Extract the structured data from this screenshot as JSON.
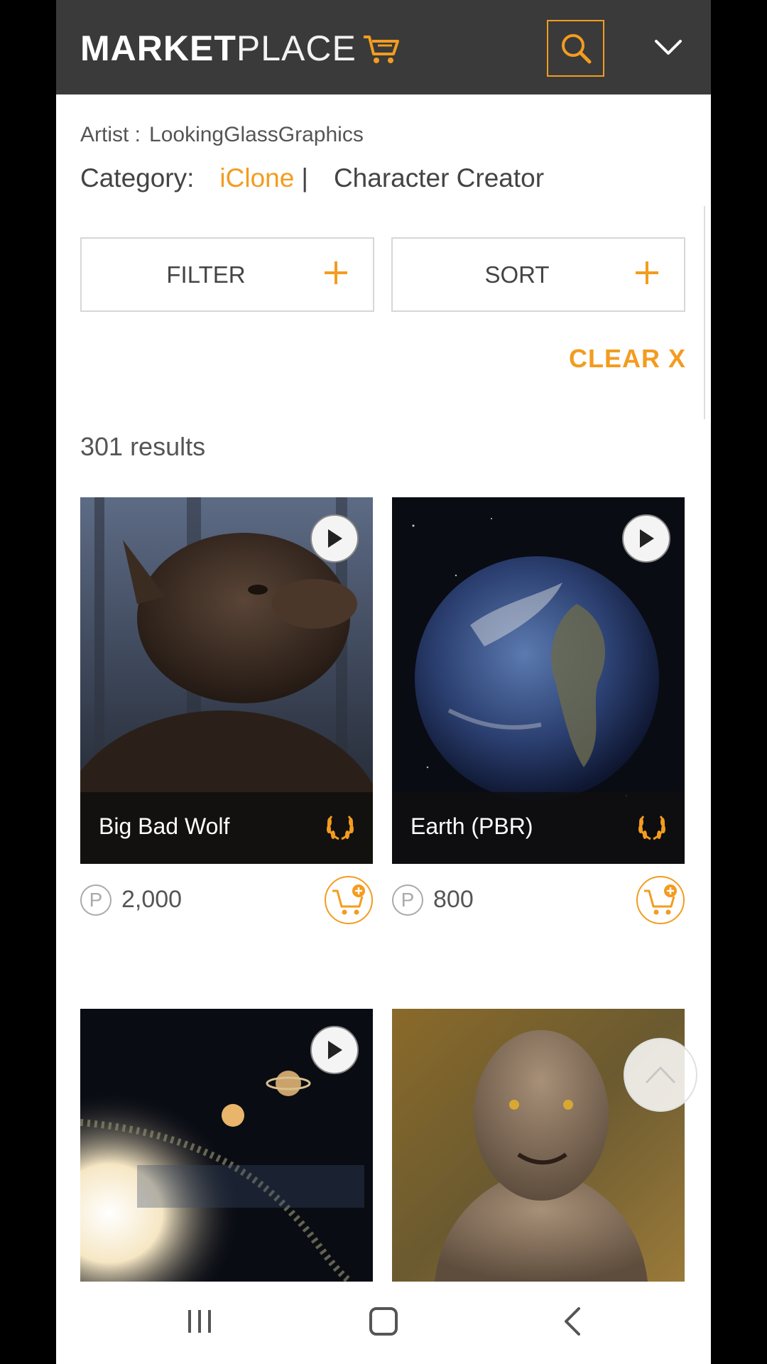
{
  "header": {
    "logo_bold": "MARKET",
    "logo_light": "PLACE",
    "search_icon": "search-icon",
    "menu_icon": "chevron-down-icon"
  },
  "meta": {
    "artist_label": "Artist :",
    "artist_name": "LookingGlassGraphics",
    "category_label": "Category:",
    "category_active": "iClone",
    "category_sep": "|",
    "category_other": "Character Creator"
  },
  "controls": {
    "filter_label": "FILTER",
    "sort_label": "SORT",
    "clear_label": "CLEAR  X"
  },
  "results": {
    "count_text": "301 results"
  },
  "products": [
    {
      "title": "Big Bad Wolf",
      "price": "2,000",
      "currency_symbol": "P"
    },
    {
      "title": "Earth (PBR)",
      "price": "800",
      "currency_symbol": "P"
    },
    {
      "title": "",
      "price": "",
      "currency_symbol": ""
    },
    {
      "title": "",
      "price": "",
      "currency_symbol": ""
    }
  ],
  "colors": {
    "accent": "#f39c1f",
    "header_bg": "#3a3a3a"
  }
}
